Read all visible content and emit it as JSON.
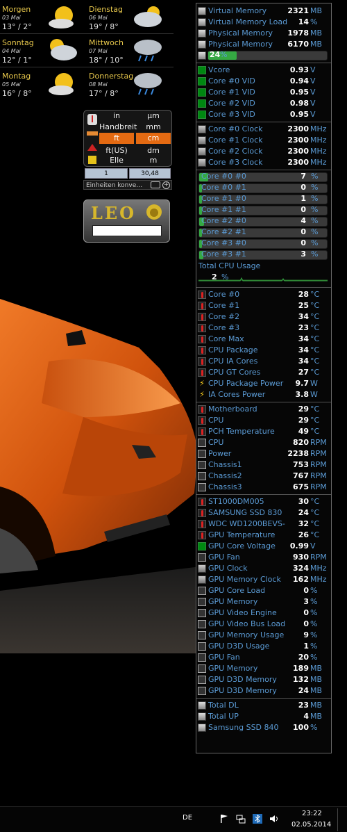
{
  "weather": {
    "days": [
      {
        "day": "Morgen",
        "date": "03 Mai",
        "temp": "13° / 2°",
        "icon": "sun-cloud-icon"
      },
      {
        "day": "Dienstag",
        "date": "06 Mai",
        "temp": "19° / 8°",
        "icon": "cloud-sun-icon"
      },
      {
        "day": "Sonntag",
        "date": "04 Mai",
        "temp": "12° / 1°",
        "icon": "cloud-sun-icon"
      },
      {
        "day": "Mittwoch",
        "date": "07 Mai",
        "temp": "18° / 10°",
        "icon": "rain-cloud-icon"
      },
      {
        "day": "Montag",
        "date": "05 Mai",
        "temp": "16° / 8°",
        "icon": "sun-cloud-icon"
      },
      {
        "day": "Donnerstag",
        "date": "08 Mai",
        "temp": "17° / 8°",
        "icon": "rain-cloud-icon"
      }
    ]
  },
  "converter": {
    "units_left": [
      "in",
      "Handbreit",
      "ft",
      "ft(US)",
      "Elle"
    ],
    "units_right": [
      "µm",
      "mm",
      "cm",
      "dm",
      "m"
    ],
    "input_left": "1",
    "input_right": "30,48",
    "footer": "Einheiten konve…",
    "selected_index": 2
  },
  "leo": {
    "logo": "LEO"
  },
  "sensors": {
    "memory": [
      {
        "label": "Virtual Memory",
        "value": "2321",
        "unit": "MB",
        "icon": "memory-icon"
      },
      {
        "label": "Virtual Memory Load",
        "value": "14",
        "unit": "%",
        "icon": "memory-icon"
      },
      {
        "label": "Physical Memory",
        "value": "1978",
        "unit": "MB",
        "icon": "memory-icon"
      },
      {
        "label": "Physical Memory",
        "value": "6170",
        "unit": "MB",
        "icon": "memory-icon"
      }
    ],
    "memory_bar": {
      "value": "24",
      "unit": "%",
      "fraction": 0.24
    },
    "voltages": [
      {
        "label": "Vcore",
        "value": "0.93",
        "unit": "V"
      },
      {
        "label": "Core #0 VID",
        "value": "0.94",
        "unit": "V"
      },
      {
        "label": "Core #1 VID",
        "value": "0.95",
        "unit": "V"
      },
      {
        "label": "Core #2 VID",
        "value": "0.98",
        "unit": "V"
      },
      {
        "label": "Core #3 VID",
        "value": "0.95",
        "unit": "V"
      }
    ],
    "clocks": [
      {
        "label": "Core #0 Clock",
        "value": "2300",
        "unit": "MHz"
      },
      {
        "label": "Core #1 Clock",
        "value": "2300",
        "unit": "MHz"
      },
      {
        "label": "Core #2 Clock",
        "value": "2300",
        "unit": "MHz"
      },
      {
        "label": "Core #3 Clock",
        "value": "2300",
        "unit": "MHz"
      }
    ],
    "core_loads": [
      {
        "label": "Core #0 #0",
        "value": "7",
        "unit": "%",
        "fraction": 0.07
      },
      {
        "label": "Core #0 #1",
        "value": "0",
        "unit": "%",
        "fraction": 0.0
      },
      {
        "label": "Core #1 #0",
        "value": "1",
        "unit": "%",
        "fraction": 0.01
      },
      {
        "label": "Core #1 #1",
        "value": "0",
        "unit": "%",
        "fraction": 0.0
      },
      {
        "label": "Core #2 #0",
        "value": "4",
        "unit": "%",
        "fraction": 0.04
      },
      {
        "label": "Core #2 #1",
        "value": "0",
        "unit": "%",
        "fraction": 0.0
      },
      {
        "label": "Core #3 #0",
        "value": "0",
        "unit": "%",
        "fraction": 0.0
      },
      {
        "label": "Core #3 #1",
        "value": "3",
        "unit": "%",
        "fraction": 0.03
      }
    ],
    "total_cpu": {
      "label": "Total CPU Usage",
      "value": "2",
      "unit": "%"
    },
    "temps": [
      {
        "label": "Core #0",
        "value": "28",
        "unit": "°C",
        "icon": "thermometer-icon"
      },
      {
        "label": "Core #1",
        "value": "25",
        "unit": "°C",
        "icon": "thermometer-icon"
      },
      {
        "label": "Core #2",
        "value": "34",
        "unit": "°C",
        "icon": "thermometer-icon"
      },
      {
        "label": "Core #3",
        "value": "23",
        "unit": "°C",
        "icon": "thermometer-icon"
      },
      {
        "label": "Core Max",
        "value": "34",
        "unit": "°C",
        "icon": "thermometer-icon"
      },
      {
        "label": "CPU Package",
        "value": "34",
        "unit": "°C",
        "icon": "thermometer-icon"
      },
      {
        "label": "CPU IA Cores",
        "value": "34",
        "unit": "°C",
        "icon": "thermometer-icon"
      },
      {
        "label": "CPU GT Cores",
        "value": "27",
        "unit": "°C",
        "icon": "thermometer-icon"
      },
      {
        "label": "CPU Package Power",
        "value": "9.7",
        "unit": "W",
        "icon": "lightning-icon"
      },
      {
        "label": "IA Cores Power",
        "value": "3.8",
        "unit": "W",
        "icon": "lightning-icon"
      }
    ],
    "board": [
      {
        "label": "Motherboard",
        "value": "29",
        "unit": "°C",
        "icon": "thermometer-icon"
      },
      {
        "label": "CPU",
        "value": "29",
        "unit": "°C",
        "icon": "thermometer-icon"
      },
      {
        "label": "PCH Temperature",
        "value": "49",
        "unit": "°C",
        "icon": "thermometer-icon"
      },
      {
        "label": "CPU",
        "value": "820",
        "unit": "RPM",
        "icon": "fan-icon"
      },
      {
        "label": "Power",
        "value": "2238",
        "unit": "RPM",
        "icon": "fan-icon"
      },
      {
        "label": "Chassis1",
        "value": "753",
        "unit": "RPM",
        "icon": "fan-icon"
      },
      {
        "label": "Chassis2",
        "value": "767",
        "unit": "RPM",
        "icon": "fan-icon"
      },
      {
        "label": "Chassis3",
        "value": "675",
        "unit": "RPM",
        "icon": "fan-icon"
      }
    ],
    "drives_gpu": [
      {
        "label": "ST1000DM005",
        "value": "30",
        "unit": "°C",
        "icon": "thermometer-icon"
      },
      {
        "label": "SAMSUNG SSD 830",
        "value": "24",
        "unit": "°C",
        "icon": "thermometer-icon"
      },
      {
        "label": "WDC WD1200BEVS-",
        "value": "32",
        "unit": "°C",
        "icon": "thermometer-icon"
      },
      {
        "label": "GPU Temperature",
        "value": "26",
        "unit": "°C",
        "icon": "thermometer-icon"
      },
      {
        "label": "GPU Core Voltage",
        "value": "0.99",
        "unit": "V",
        "icon": "voltage-icon"
      },
      {
        "label": "GPU Fan",
        "value": "930",
        "unit": "RPM",
        "icon": "fan-icon"
      },
      {
        "label": "GPU Clock",
        "value": "324",
        "unit": "MHz",
        "icon": "clock-icon"
      },
      {
        "label": "GPU Memory Clock",
        "value": "162",
        "unit": "MHz",
        "icon": "clock-icon"
      },
      {
        "label": "GPU Core Load",
        "value": "0",
        "unit": "%",
        "icon": "fan-icon"
      },
      {
        "label": "GPU Memory",
        "value": "3",
        "unit": "%",
        "icon": "fan-icon"
      },
      {
        "label": "GPU Video Engine",
        "value": "0",
        "unit": "%",
        "icon": "fan-icon"
      },
      {
        "label": "GPU Video Bus Load",
        "value": "0",
        "unit": "%",
        "icon": "fan-icon"
      },
      {
        "label": "GPU Memory Usage",
        "value": "9",
        "unit": "%",
        "icon": "fan-icon"
      },
      {
        "label": "GPU D3D Usage",
        "value": "1",
        "unit": "%",
        "icon": "fan-icon"
      },
      {
        "label": "GPU Fan",
        "value": "20",
        "unit": "%",
        "icon": "fan-icon"
      },
      {
        "label": "GPU Memory",
        "value": "189",
        "unit": "MB",
        "icon": "fan-icon"
      },
      {
        "label": "GPU D3D Memory",
        "value": "132",
        "unit": "MB",
        "icon": "fan-icon"
      },
      {
        "label": "GPU D3D Memory",
        "value": "24",
        "unit": "MB",
        "icon": "fan-icon"
      }
    ],
    "network": [
      {
        "label": "Total DL",
        "value": "23",
        "unit": "MB",
        "icon": "memory-icon"
      },
      {
        "label": "Total UP",
        "value": "4",
        "unit": "MB",
        "icon": "memory-icon"
      },
      {
        "label": "Samsung SSD 840",
        "value": "100",
        "unit": "%",
        "icon": "memory-icon"
      }
    ]
  },
  "taskbar": {
    "language": "DE",
    "time": "23:22",
    "date": "02.05.2014"
  },
  "colors": {
    "label": "#5b9bd5",
    "accent_orange": "#e46a12",
    "bar_green": "#35a843"
  }
}
